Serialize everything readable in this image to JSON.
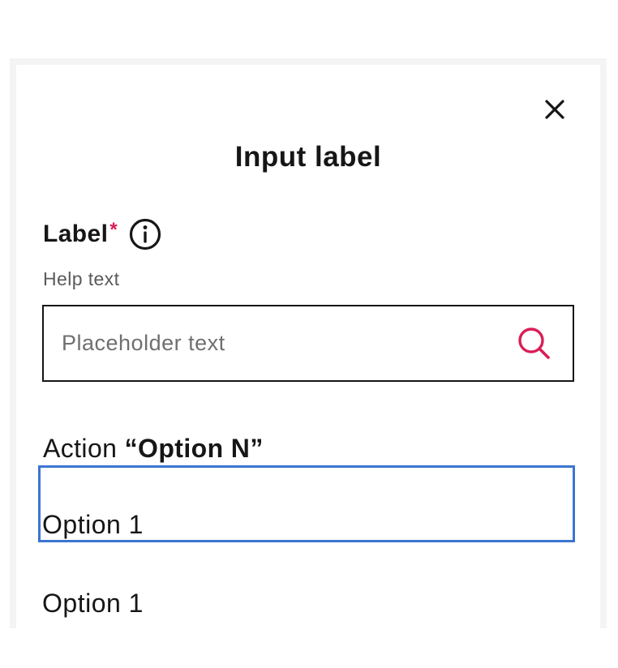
{
  "dialog": {
    "title": "Input label",
    "close_icon": "close-icon"
  },
  "field": {
    "label": "Label",
    "required_marker": "*",
    "info_icon": "info-icon",
    "help_text": "Help text",
    "search_placeholder": "Placeholder text",
    "search_value": "",
    "search_icon": "search-icon"
  },
  "action": {
    "prefix": "Action",
    "quoted_option": "“Option N”"
  },
  "options": [
    {
      "label": "Option 1",
      "focused": true
    },
    {
      "label": "Option 1",
      "focused": false
    }
  ],
  "colors": {
    "accent": "#da1e57",
    "focus_outline": "#3b75d1",
    "text": "#161616",
    "helper": "#5a5a5a"
  }
}
